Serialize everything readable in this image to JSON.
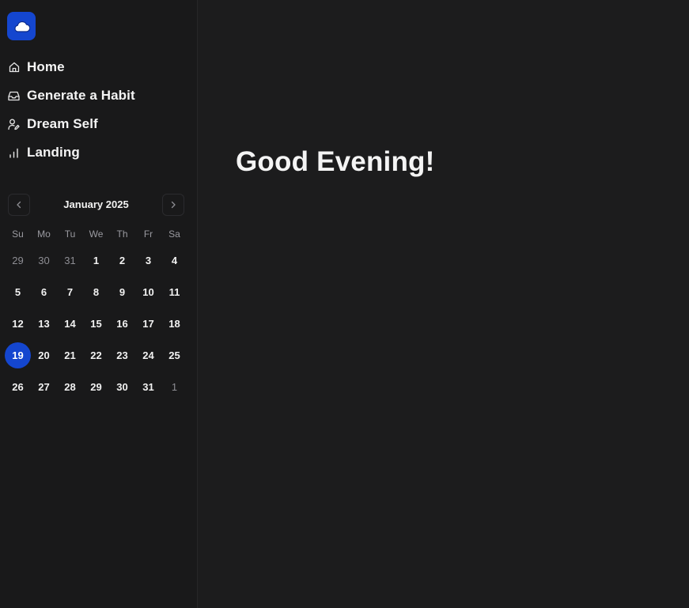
{
  "sidebar": {
    "logo_icon": "cloud-icon",
    "nav": [
      {
        "label": "Home",
        "icon": "home-icon"
      },
      {
        "label": "Generate a Habit",
        "icon": "inbox-icon"
      },
      {
        "label": "Dream Self",
        "icon": "user-edit-icon"
      },
      {
        "label": "Landing",
        "icon": "bar-chart-icon"
      }
    ]
  },
  "calendar": {
    "month_label": "January 2025",
    "weekdays": [
      "Su",
      "Mo",
      "Tu",
      "We",
      "Th",
      "Fr",
      "Sa"
    ],
    "weeks": [
      [
        "29",
        "30",
        "31",
        "1",
        "2",
        "3",
        "4"
      ],
      [
        "5",
        "6",
        "7",
        "8",
        "9",
        "10",
        "11"
      ],
      [
        "12",
        "13",
        "14",
        "15",
        "16",
        "17",
        "18"
      ],
      [
        "19",
        "20",
        "21",
        "22",
        "23",
        "24",
        "25"
      ],
      [
        "26",
        "27",
        "28",
        "29",
        "30",
        "31",
        "1"
      ]
    ],
    "selected_day": "19"
  },
  "main": {
    "greeting": "Good Evening!"
  },
  "colors": {
    "accent": "#1446cf",
    "sidebar_bg": "#19191a",
    "main_bg": "#1c1c1d"
  }
}
